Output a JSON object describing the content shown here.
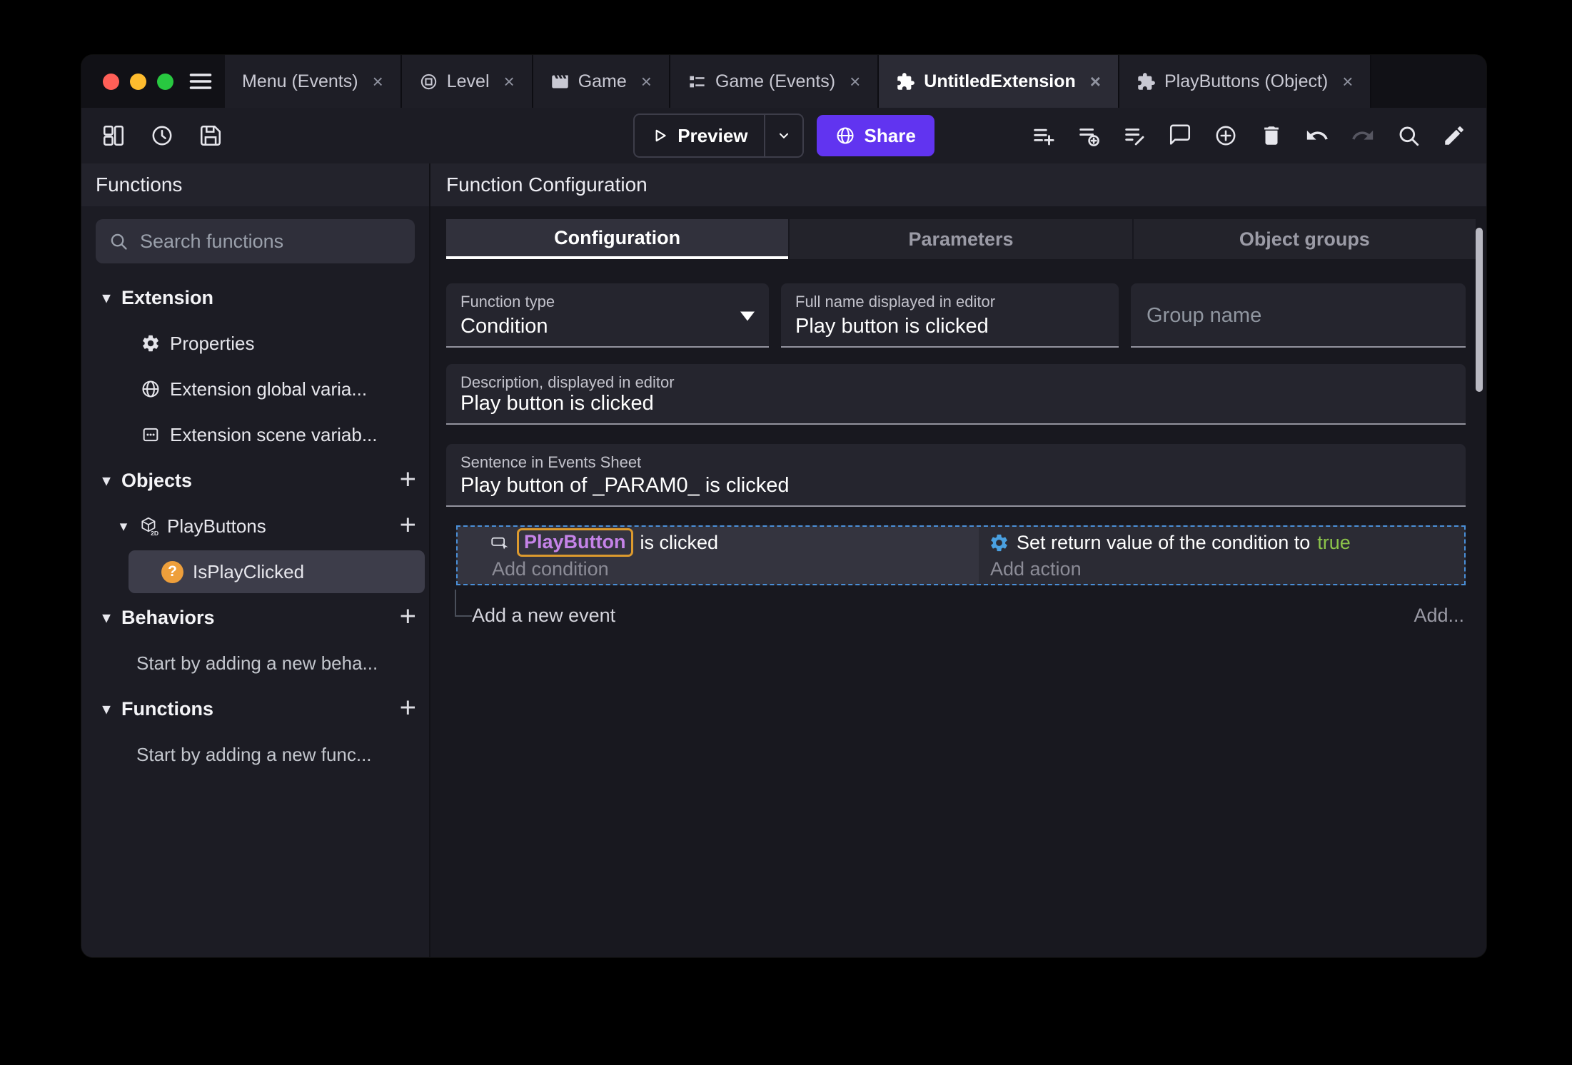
{
  "ui": {
    "close_glyph": "×",
    "chevron_down": "▾",
    "plus_glyph": "+",
    "question_glyph": "?"
  },
  "window": {
    "tabs": [
      {
        "label": "Menu (Events)"
      },
      {
        "label": "Level"
      },
      {
        "label": "Game"
      },
      {
        "label": "Game (Events)"
      },
      {
        "label": "UntitledExtension"
      },
      {
        "label": "PlayButtons (Object)"
      }
    ]
  },
  "toolbar": {
    "preview": "Preview",
    "share": "Share"
  },
  "sidebar": {
    "title": "Functions",
    "search_placeholder": "Search functions",
    "extension_header": "Extension",
    "extension_items": [
      "Properties",
      "Extension global varia...",
      "Extension scene variab..."
    ],
    "objects_header": "Objects",
    "object_name": "PlayButtons",
    "function_name": "IsPlayClicked",
    "behaviors_header": "Behaviors",
    "behaviors_empty": "Start by adding a new beha...",
    "functions_header": "Functions",
    "functions_empty": "Start by adding a new func..."
  },
  "main": {
    "title": "Function Configuration",
    "tabs": [
      "Configuration",
      "Parameters",
      "Object groups"
    ],
    "function_type_label": "Function type",
    "function_type_value": "Condition",
    "full_name_label": "Full name displayed in editor",
    "full_name_value": "Play button is clicked",
    "group_name_placeholder": "Group name",
    "description_label": "Description, displayed in editor",
    "description_value": "Play button is clicked",
    "sentence_label": "Sentence in Events Sheet",
    "sentence_value": "Play button of _PARAM0_ is clicked",
    "event": {
      "condition_object": "PlayButton",
      "condition_suffix": "is clicked",
      "add_condition": "Add condition",
      "action_text": "Set return value of the condition to",
      "action_value": "true",
      "add_action": "Add action"
    },
    "add_new_event": "Add a new event",
    "add_more": "Add..."
  },
  "colors": {
    "accent_purple": "#6134f0",
    "object_chip_border": "#dc9a2e",
    "object_name_text": "#c583e8",
    "true_green": "#8bc34a",
    "gear_blue": "#4aa0e0",
    "selection_dashed": "#4a8fd8"
  }
}
